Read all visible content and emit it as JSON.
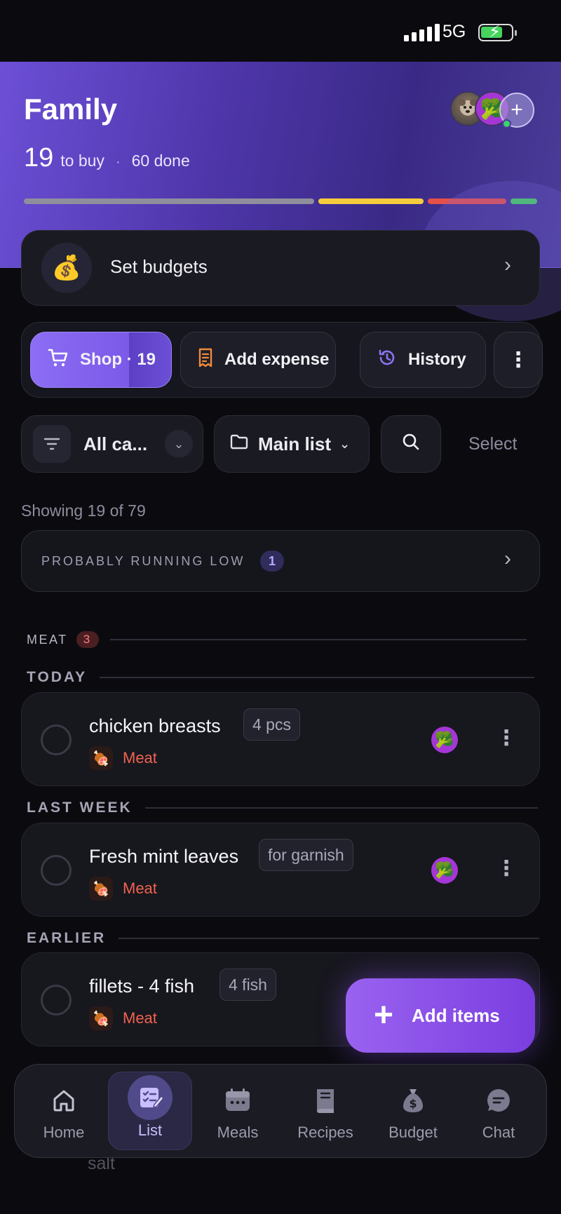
{
  "status": {
    "network": "5G"
  },
  "header": {
    "title": "Family",
    "to_buy_count": "19",
    "to_buy_label": "to buy",
    "separator": "·",
    "done_label": "60 done",
    "add_member_symbol": "+",
    "progress_colors": [
      "#8f8e9c",
      "#f5cd3c",
      "#e5504a",
      "#46d35e"
    ]
  },
  "budget": {
    "label": "Set budgets",
    "icon": "money-bag-icon"
  },
  "actions": {
    "shop_label": "Shop · 19",
    "add_expense_label": "Add expense",
    "history_label": "History"
  },
  "filters": {
    "category": "All ca...",
    "list": "Main list",
    "select_label": "Select"
  },
  "showing": "Showing 19 of 79",
  "running_low": {
    "label": "PROBABLY RUNNING LOW",
    "count": "1"
  },
  "section": {
    "name": "MEAT",
    "count": "3"
  },
  "groups": {
    "today": "TODAY",
    "last_week": "LAST WEEK",
    "earlier": "EARLIER"
  },
  "items": [
    {
      "name": "chicken breasts",
      "qty": "4 pcs",
      "category": "Meat"
    },
    {
      "name": "Fresh mint leaves",
      "qty": "for garnish",
      "category": "Meat"
    },
    {
      "name": "fillets - 4 fish",
      "qty": "4 fish",
      "category": "Meat"
    }
  ],
  "ghost_item": "salt",
  "fab": {
    "label": "Add items"
  },
  "nav": [
    {
      "label": "Home",
      "icon": "home-icon"
    },
    {
      "label": "List",
      "icon": "list-icon"
    },
    {
      "label": "Meals",
      "icon": "calendar-icon"
    },
    {
      "label": "Recipes",
      "icon": "book-icon"
    },
    {
      "label": "Budget",
      "icon": "money-bag-icon"
    },
    {
      "label": "Chat",
      "icon": "chat-icon"
    }
  ]
}
